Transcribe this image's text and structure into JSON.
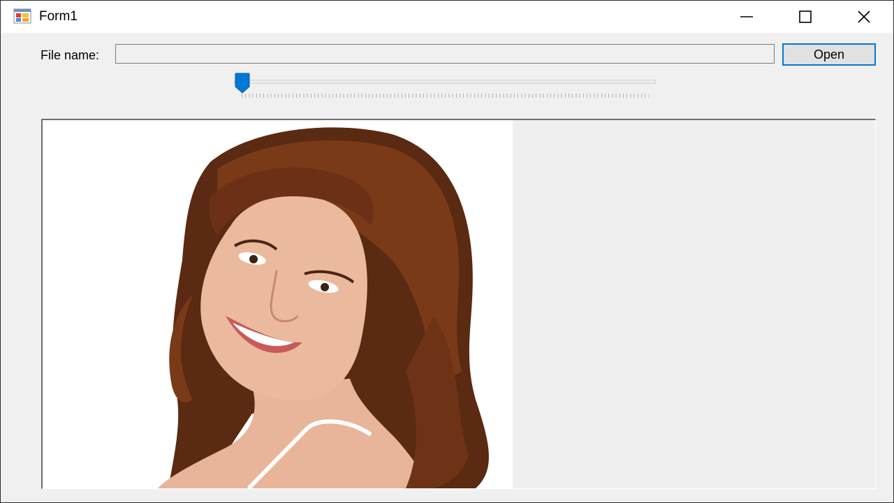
{
  "window": {
    "title": "Form1",
    "icon": "winforms-app-icon",
    "controls": {
      "minimize": "minimize-icon",
      "maximize": "maximize-icon",
      "close": "close-icon"
    }
  },
  "form": {
    "file_label": "File name:",
    "file_value": "",
    "open_label": "Open",
    "slider_value": 0
  },
  "picture": {
    "subject": "portrait-photo"
  },
  "colors": {
    "accent": "#0078d7",
    "window_bg": "#f0f0f0",
    "hair": "#6a3318",
    "skin": "#e9b597"
  }
}
